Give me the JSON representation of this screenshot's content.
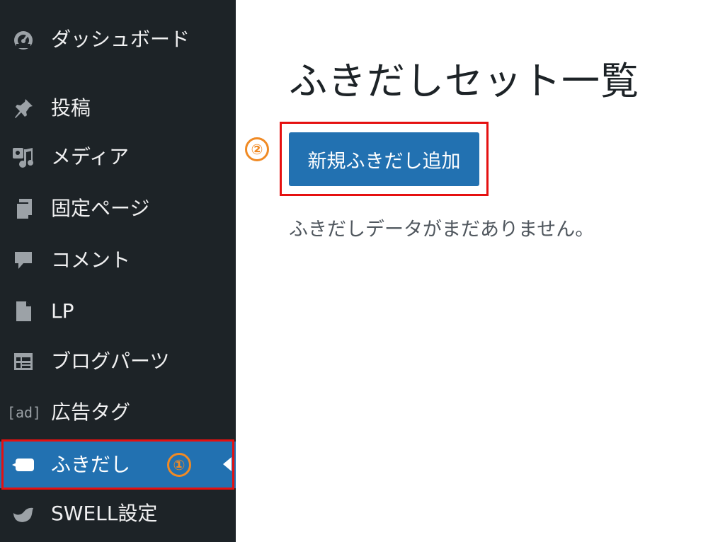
{
  "sidebar": {
    "items": [
      {
        "label": "ダッシュボード",
        "icon": "dashboard-icon"
      },
      {
        "label": "投稿",
        "icon": "pin-icon"
      },
      {
        "label": "メディア",
        "icon": "media-icon"
      },
      {
        "label": "固定ページ",
        "icon": "pages-icon"
      },
      {
        "label": "コメント",
        "icon": "comment-icon"
      },
      {
        "label": "LP",
        "icon": "document-icon"
      },
      {
        "label": "ブログパーツ",
        "icon": "grid-icon"
      },
      {
        "label": "広告タグ",
        "icon": "ad-icon"
      },
      {
        "label": "ふきだし",
        "icon": "speech-bubble-icon",
        "active": true
      },
      {
        "label": "SWELL設定",
        "icon": "swell-icon"
      }
    ],
    "ad_icon_text": "[ad]",
    "active_badge": "①"
  },
  "main": {
    "title": "ふきだしセット一覧",
    "step_badge": "②",
    "add_button_label": "新規ふきだし追加",
    "empty_message": "ふきだしデータがまだありません。"
  },
  "colors": {
    "sidebar_bg": "#1d2327",
    "accent": "#2271b1",
    "highlight": "#e51010",
    "badge": "#f08a24"
  }
}
